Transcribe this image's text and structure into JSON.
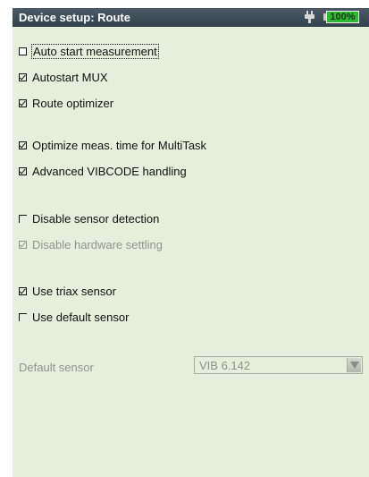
{
  "title": "Device setup: Route",
  "battery": {
    "percent_label": "100%",
    "level": 1.0
  },
  "options": [
    {
      "label": "Auto start measurement",
      "state": "unchecked",
      "focused": true,
      "enabled": true
    },
    {
      "label": "Autostart MUX",
      "state": "checked",
      "enabled": true
    },
    {
      "label": "Route optimizer",
      "state": "checked",
      "enabled": true
    },
    {
      "label": "Optimize meas. time for MultiTask",
      "state": "checked",
      "enabled": true
    },
    {
      "label": "Advanced VIBCODE handling",
      "state": "checked",
      "enabled": true
    },
    {
      "label": "Disable sensor detection",
      "state": "unchecked",
      "enabled": true
    },
    {
      "label": "Disable hardware settling",
      "state": "checked",
      "enabled": false
    },
    {
      "label": "Use triax sensor",
      "state": "checked",
      "enabled": true
    },
    {
      "label": "Use default sensor",
      "state": "unchecked",
      "enabled": true
    }
  ],
  "default_sensor": {
    "label": "Default sensor",
    "value": "VIB 6.142",
    "enabled": false
  }
}
